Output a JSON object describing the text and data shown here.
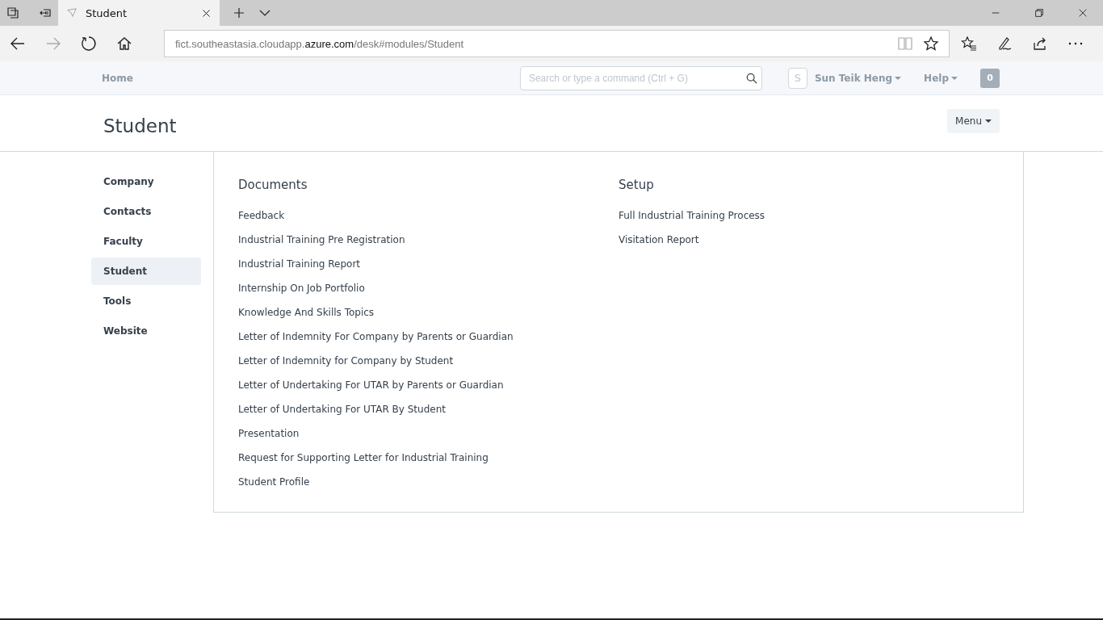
{
  "browser": {
    "tab_title": "Student",
    "url_parts": [
      {
        "text": "fict.southeastasia.cloudapp.",
        "emphasis": false
      },
      {
        "text": "azure.com",
        "emphasis": true
      },
      {
        "text": "/desk#modules/Student",
        "emphasis": false
      }
    ]
  },
  "navbar": {
    "home": "Home",
    "search": {
      "placeholder": "Search or type a command (Ctrl + G)"
    },
    "avatar_letter": "S",
    "user": "Sun Teik Heng",
    "help": "Help",
    "notifications": "0"
  },
  "page": {
    "title": "Student",
    "menu_button": "Menu"
  },
  "sidebar": {
    "items": [
      {
        "label": "Company",
        "selected": false
      },
      {
        "label": "Contacts",
        "selected": false
      },
      {
        "label": "Faculty",
        "selected": false
      },
      {
        "label": "Student",
        "selected": true
      },
      {
        "label": "Tools",
        "selected": false
      },
      {
        "label": "Website",
        "selected": false
      }
    ]
  },
  "sections": [
    {
      "title": "Documents",
      "links": [
        "Feedback",
        "Industrial Training Pre Registration",
        "Industrial Training Report",
        "Internship On Job Portfolio",
        "Knowledge And Skills Topics",
        "Letter of Indemnity For Company by Parents or Guardian",
        "Letter of Indemnity for Company by Student",
        "Letter of Undertaking For UTAR by Parents or Guardian",
        "Letter of Undertaking For UTAR By Student",
        "Presentation",
        "Request for Supporting Letter for Industrial Training",
        "Student Profile"
      ]
    },
    {
      "title": "Setup",
      "links": [
        "Full Industrial Training Process",
        "Visitation Report"
      ]
    }
  ]
}
